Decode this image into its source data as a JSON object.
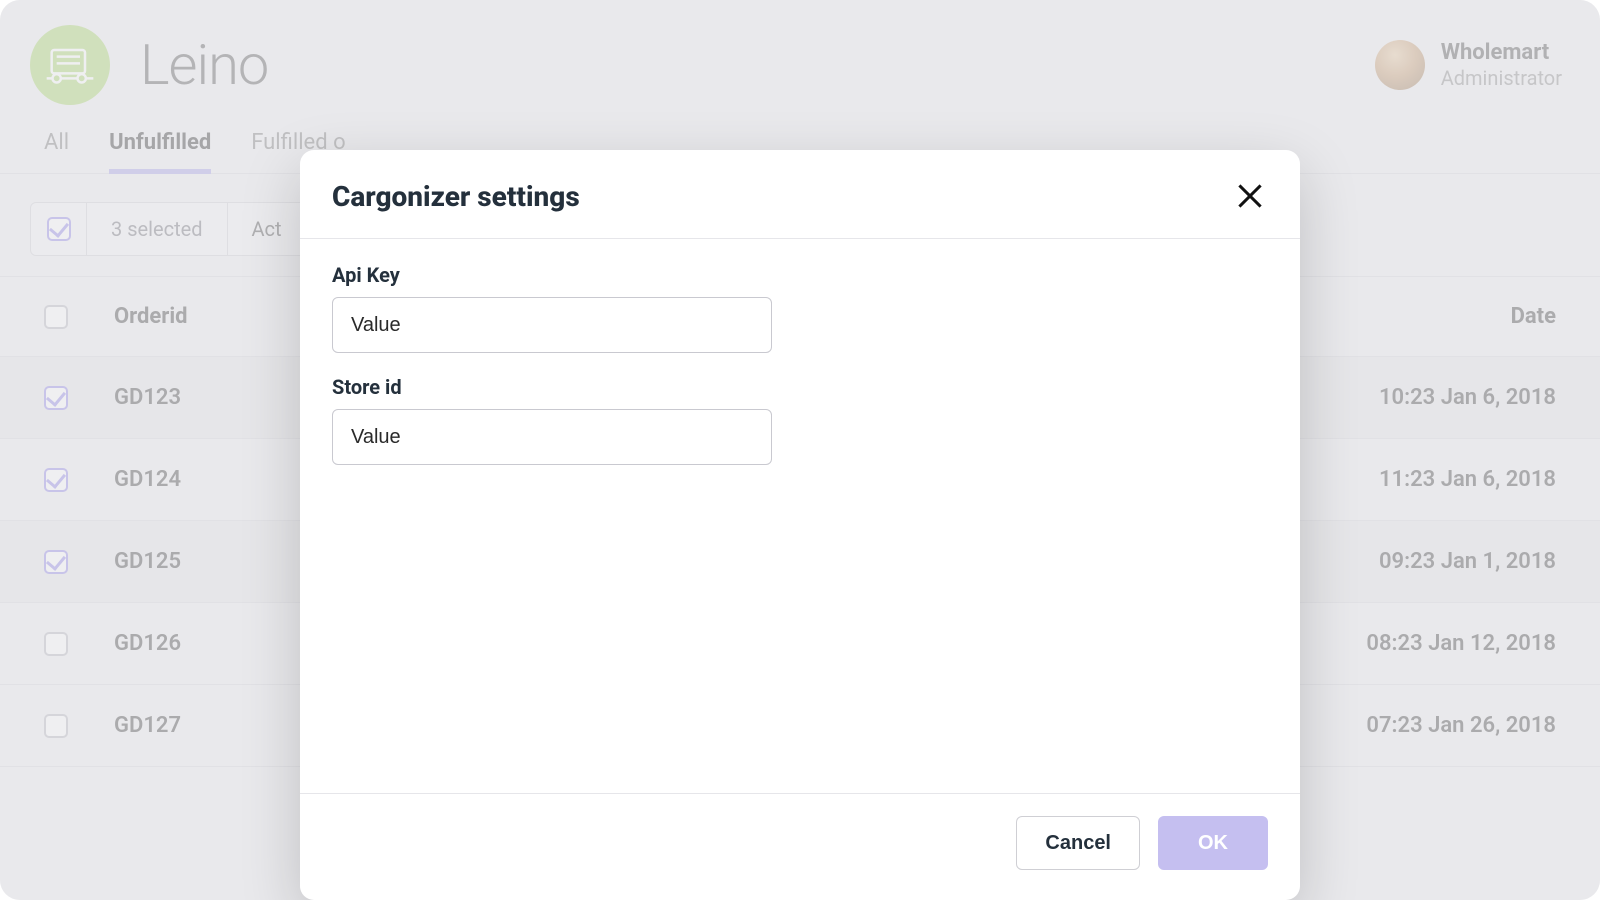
{
  "header": {
    "brand": "Leino",
    "user": {
      "name": "Wholemart",
      "role": "Administrator"
    }
  },
  "tabs": {
    "items": [
      {
        "label": "All",
        "active": false
      },
      {
        "label": "Unfulfilled",
        "active": true
      },
      {
        "label": "Fulfilled o",
        "active": false
      }
    ]
  },
  "toolbar": {
    "selected_label": "3 selected",
    "actions_label": "Act"
  },
  "table": {
    "columns": {
      "order": "Orderid",
      "date": "Date"
    },
    "rows": [
      {
        "id": "GD123",
        "date": "10:23 Jan 6, 2018",
        "checked": true
      },
      {
        "id": "GD124",
        "date": "11:23 Jan 6, 2018",
        "checked": true
      },
      {
        "id": "GD125",
        "date": "09:23 Jan 1, 2018",
        "checked": true
      },
      {
        "id": "GD126",
        "date": "08:23 Jan 12, 2018",
        "checked": false
      },
      {
        "id": "GD127",
        "date": "07:23 Jan 26, 2018",
        "checked": false
      }
    ]
  },
  "modal": {
    "title": "Cargonizer settings",
    "fields": {
      "api_key": {
        "label": "Api Key",
        "placeholder": "Value",
        "value": ""
      },
      "store_id": {
        "label": "Store id",
        "placeholder": "Value",
        "value": ""
      }
    },
    "buttons": {
      "cancel": "Cancel",
      "ok": "OK"
    }
  }
}
